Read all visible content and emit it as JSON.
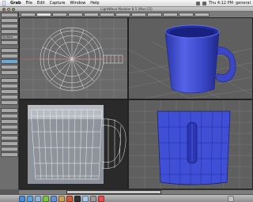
{
  "menubar": {
    "apple": "",
    "items": [
      "Grab",
      "File",
      "Edit",
      "Capture",
      "Window",
      "Help"
    ],
    "clock": "Thu 4:12 PM",
    "user": "general"
  },
  "window": {
    "title": "LightWave Modeler 8.5 (Mac:G5)"
  },
  "toolbar": {
    "items": [
      "",
      "",
      "",
      "",
      "Surface",
      "",
      "",
      "",
      "",
      "",
      "",
      "",
      "",
      "",
      "",
      "",
      "",
      "",
      "",
      "",
      "",
      "",
      "",
      "",
      ""
    ]
  },
  "statusbar": {
    "message": ""
  },
  "colors": {
    "mesh_blue": "#3f4fd6",
    "wire_white": "#e9e9e9",
    "grid": "#8a8a8a",
    "bg_gray": "#6a6a6a"
  },
  "dock": {
    "icons": [
      "finder-icon",
      "safari-icon",
      "mail-icon",
      "ichat-icon",
      "itunes-icon",
      "iphoto-icon",
      "lightwave-icon",
      "terminal-icon",
      "preview-icon",
      "system-prefs-icon",
      "calendar-icon",
      "trash-icon"
    ]
  }
}
